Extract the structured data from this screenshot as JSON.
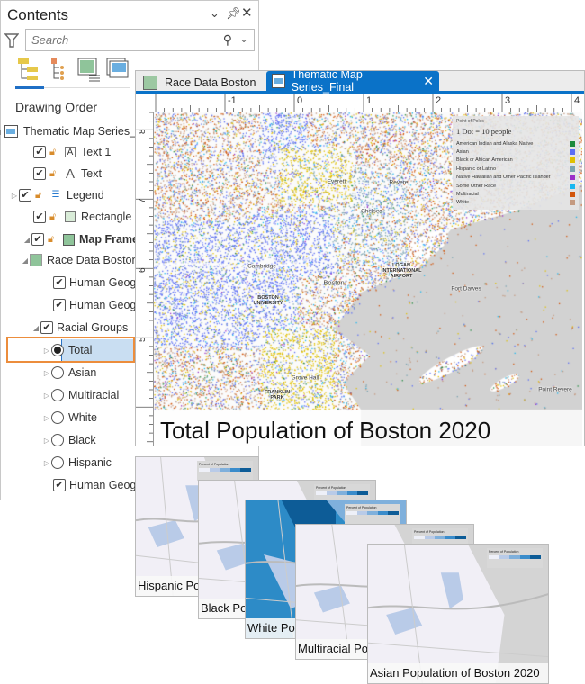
{
  "contents": {
    "title": "Contents",
    "search_placeholder": "Search",
    "section": "Drawing Order",
    "view_tabs": [
      "list-by-drawing-order",
      "list-by-selection",
      "list-by-map-frames",
      "list-by-map-series"
    ],
    "items": [
      {
        "label": "Thematic Map Series_",
        "type": "layout",
        "expanded": true
      },
      {
        "label": "Text 1",
        "checked": true,
        "icon": "text-box"
      },
      {
        "label": "Text",
        "checked": true,
        "icon": "text"
      },
      {
        "label": "Legend",
        "checked": true,
        "icon": "legend",
        "expandable": true
      },
      {
        "label": "Rectangle",
        "checked": true,
        "icon": "rectangle"
      },
      {
        "label": "Map Frame",
        "checked": true,
        "icon": "map-frame",
        "bold": true,
        "expanded": true
      },
      {
        "label": "Race Data Boston",
        "icon": "map",
        "expanded": true
      },
      {
        "label": "Human Geography",
        "checked": true
      },
      {
        "label": "Human Geography",
        "checked": true
      },
      {
        "label": "Racial Groups",
        "checked": true,
        "expanded": true
      },
      {
        "label": "Total",
        "radio": true,
        "selected": true
      },
      {
        "label": "Asian",
        "radio": true
      },
      {
        "label": "Multiracial",
        "radio": true
      },
      {
        "label": "White",
        "radio": true
      },
      {
        "label": "Black",
        "radio": true
      },
      {
        "label": "Hispanic",
        "radio": true
      },
      {
        "label": "Human Geography",
        "checked": true
      }
    ]
  },
  "map_window": {
    "tabs": [
      {
        "label": "Race Data Boston",
        "active": false
      },
      {
        "label": "Thematic Map Series_Final",
        "active": true
      }
    ],
    "ruler_top": [
      "-1",
      "0",
      "1",
      "2",
      "3",
      "4"
    ],
    "ruler_left": [
      "8",
      "7",
      "6",
      "5"
    ],
    "title": "Total  Population of Boston 2020",
    "legend": {
      "title": "Point of Poles",
      "scale": "1 Dot = 10 people",
      "items": [
        {
          "label": "American Indian and Alaska Native",
          "color": "#1e8a3c"
        },
        {
          "label": "Asian",
          "color": "#5b6ef5"
        },
        {
          "label": "Black or African American",
          "color": "#e0c000"
        },
        {
          "label": "Hispanic or Latino",
          "color": "#7aa3b0"
        },
        {
          "label": "Native Hawaiian and Other Pacific Islander",
          "color": "#9b2fc8"
        },
        {
          "label": "Some Other Race",
          "color": "#19b7f0"
        },
        {
          "label": "Multiracial",
          "color": "#d2560c"
        },
        {
          "label": "White",
          "color": "#c49a80"
        }
      ]
    },
    "place_labels": [
      "Everett",
      "Revere",
      "Chelsea",
      "Cambridge",
      "Boston",
      "LOGAN INTERNATIONAL AIRPORT",
      "BOSTON UNIVERSITY",
      "FRANKLIN PARK",
      "Grove Hall",
      "Fort Dawes",
      "Point Revere"
    ]
  },
  "thumbnails": [
    {
      "caption": "Hispanic Pop",
      "fill": "light"
    },
    {
      "caption": "Black Pop",
      "fill": "light"
    },
    {
      "caption": "White Pop",
      "fill": "dark"
    },
    {
      "caption": "Multiracial Pop",
      "fill": "light"
    },
    {
      "caption": "Asian Population of Boston 2020",
      "fill": "light"
    }
  ],
  "thumb_legend": {
    "title": "Percent of Population",
    "ramp": [
      "#eef0f8",
      "#b9cbe8",
      "#7fb0dc",
      "#3a8ccb",
      "#0d5c97"
    ]
  }
}
